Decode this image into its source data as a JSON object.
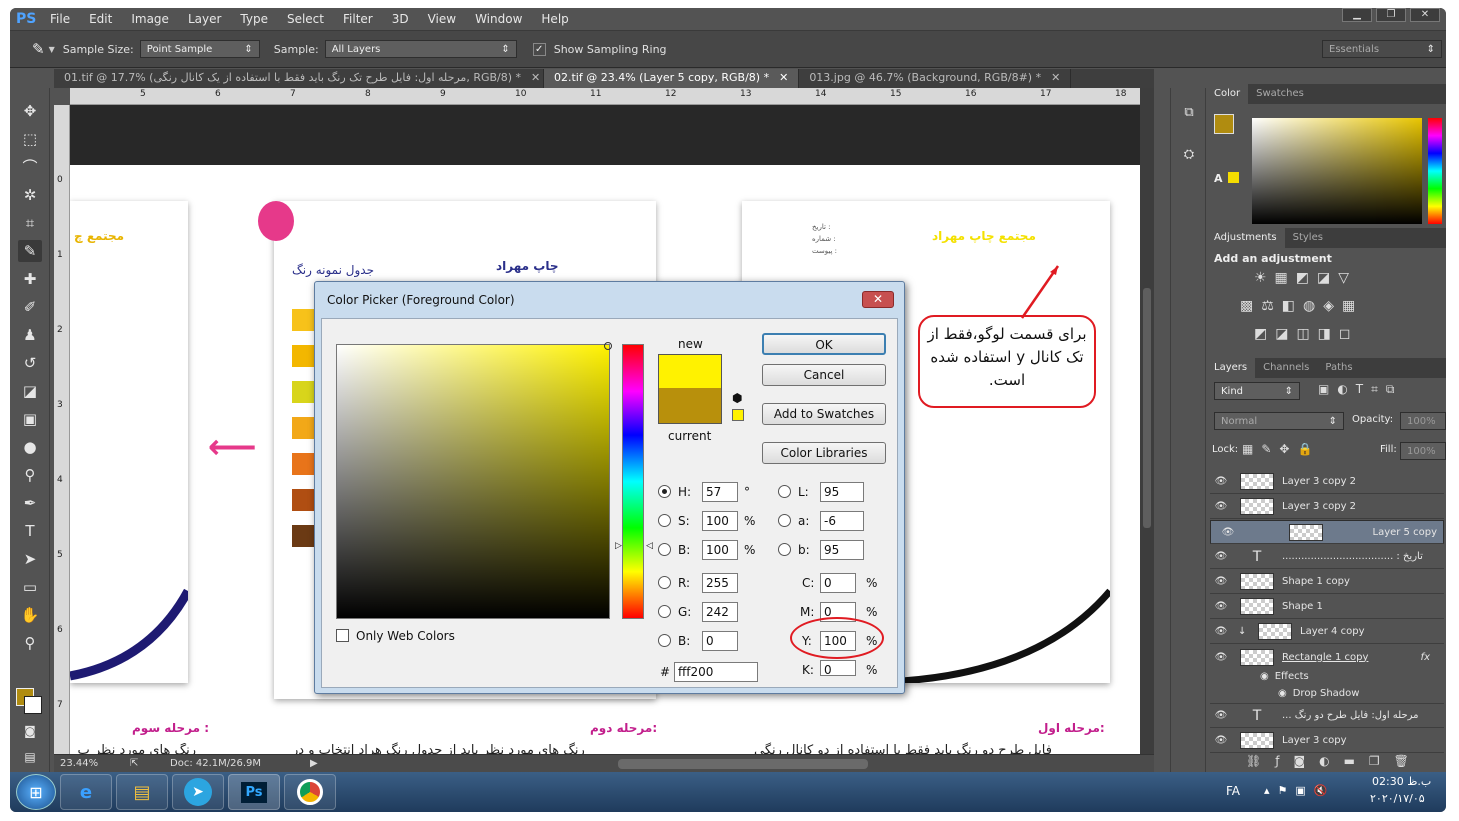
{
  "menu": {
    "app_logo": "PS",
    "items": [
      "File",
      "Edit",
      "Image",
      "Layer",
      "Type",
      "Select",
      "Filter",
      "3D",
      "View",
      "Window",
      "Help"
    ]
  },
  "options": {
    "sample_size_label": "Sample Size:",
    "sample_size_value": "Point Sample",
    "sample_label": "Sample:",
    "sample_value": "All Layers",
    "ring_label": "Show Sampling Ring",
    "workspace": "Essentials"
  },
  "tabs": [
    {
      "label": "01.tif @ 17.7% (مرحله اول: فایل طرح تک رنگ باید فقط با استفاده از یک کانال رنگی, RGB/8) *"
    },
    {
      "label": "02.tif @ 23.4% (Layer 5 copy, RGB/8) *"
    },
    {
      "label": "013.jpg @ 46.7% (Background, RGB/8#) *"
    }
  ],
  "ruler_top": [
    "5",
    "6",
    "7",
    "8",
    "9",
    "10",
    "11",
    "12",
    "13",
    "14",
    "15",
    "16",
    "17",
    "18"
  ],
  "ruler_left": [
    "0",
    "1",
    "2",
    "3",
    "4",
    "5",
    "6",
    "7"
  ],
  "canvas": {
    "logo_text": "مجتمع چاپ مهراد",
    "logo_short": "مجتمع چ",
    "table_title": "جدول نمونه رنگ",
    "logo_mid": "چاپ مهراد",
    "form_lines": [
      "تاریخ :",
      "شماره :",
      "پیوست :"
    ],
    "step3_caption": "مرحله سوم :",
    "step2_caption": "مرحله دوم:",
    "step1_caption": "مرحله اول:",
    "step3_text": "رنگ های مورد نظر پ",
    "step2_text": "رنگ های مورد نظر باید از جدول رنگ هراد انتخاب و در",
    "step1_text": "فایل طرح دو رنگ باید فقط با استفاده از دو کانال رنگی",
    "callout_text": "برای قسمت لوگو،فقط از تک کانال y استفاده شده است."
  },
  "status": {
    "zoom": "23.44%",
    "doc": "Doc: 42.1M/26.9M"
  },
  "dialog": {
    "title": "Color Picker (Foreground Color)",
    "new_label": "new",
    "current_label": "current",
    "ok": "OK",
    "cancel": "Cancel",
    "add_swatches": "Add to Swatches",
    "libraries": "Color Libraries",
    "only_web": "Only Web Colors",
    "hsb": [
      {
        "label": "H:",
        "value": "57",
        "unit": "°"
      },
      {
        "label": "S:",
        "value": "100",
        "unit": "%"
      },
      {
        "label": "B:",
        "value": "100",
        "unit": "%"
      }
    ],
    "rgb": [
      {
        "label": "R:",
        "value": "255"
      },
      {
        "label": "G:",
        "value": "242"
      },
      {
        "label": "B:",
        "value": "0"
      }
    ],
    "lab": [
      {
        "label": "L:",
        "value": "95"
      },
      {
        "label": "a:",
        "value": "-6"
      },
      {
        "label": "b:",
        "value": "95"
      }
    ],
    "cmyk": [
      {
        "label": "C:",
        "value": "0",
        "unit": "%"
      },
      {
        "label": "M:",
        "value": "0",
        "unit": "%"
      },
      {
        "label": "Y:",
        "value": "100",
        "unit": "%"
      },
      {
        "label": "K:",
        "value": "0",
        "unit": "%"
      }
    ],
    "hex_label": "#",
    "hex": "fff200",
    "new_color": "#fff200",
    "current_color": "#b8900c"
  },
  "panels": {
    "color_tabs": [
      "Color",
      "Swatches"
    ],
    "adj_tabs": [
      "Adjustments",
      "Styles"
    ],
    "add_adjustment": "Add an adjustment",
    "layers_tabs": [
      "Layers",
      "Channels",
      "Paths"
    ],
    "kind": "Kind",
    "blend": "Normal",
    "opacity_label": "Opacity:",
    "opacity": "100%",
    "lock_label": "Lock:",
    "fill_label": "Fill:",
    "fill": "100%",
    "layers": [
      "Layer 3 copy 2",
      "Layer 3 copy 2",
      "Layer 5 copy",
      "تاریخ : ...................................",
      "Shape 1 copy",
      "Shape 1",
      "Layer 4 copy",
      "Rectangle 1 copy",
      "Effects",
      "Drop Shadow",
      "مرحله اول: فایل طرح دو رنگ ...",
      "Layer 3 copy"
    ]
  },
  "taskbar": {
    "lang": "FA",
    "time": "02:30 ب.ظ",
    "date": "۲۰۲۰/۱۷/۰۵"
  }
}
